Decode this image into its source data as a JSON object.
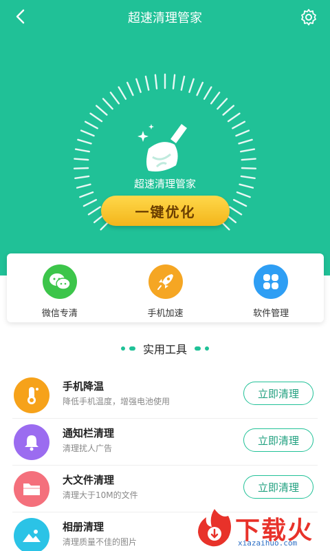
{
  "header": {
    "title": "超速清理管家"
  },
  "dial": {
    "brand_label": "超速清理管家"
  },
  "optimize_button": {
    "label": "一键优化"
  },
  "quick_actions": [
    {
      "label": "微信专清",
      "icon": "wechat-icon",
      "color": "#3cc54a"
    },
    {
      "label": "手机加速",
      "icon": "rocket-icon",
      "color": "#f5a623"
    },
    {
      "label": "软件管理",
      "icon": "apps-icon",
      "color": "#2e9ef4"
    }
  ],
  "tools": {
    "title": "实用工具",
    "items": [
      {
        "title": "手机降温",
        "subtitle": "降低手机温度，增强电池使用",
        "button": "立即清理",
        "icon": "thermometer-icon",
        "color": "#f6a21a"
      },
      {
        "title": "通知栏清理",
        "subtitle": "清理扰人广告",
        "button": "立即清理",
        "icon": "bell-icon",
        "color": "#9b6cf0"
      },
      {
        "title": "大文件清理",
        "subtitle": "清理大于10M的文件",
        "button": "立即清理",
        "icon": "folder-icon",
        "color": "#f4707c"
      },
      {
        "title": "相册清理",
        "subtitle": "清理质量不佳的图片",
        "button": "",
        "icon": "image-icon",
        "color": "#2bc3e6"
      }
    ]
  },
  "watermark": {
    "text": "下载火",
    "sub": "xiazaihuo.com"
  },
  "colors": {
    "primary": "#20c197",
    "accent": "#f3b51b"
  }
}
